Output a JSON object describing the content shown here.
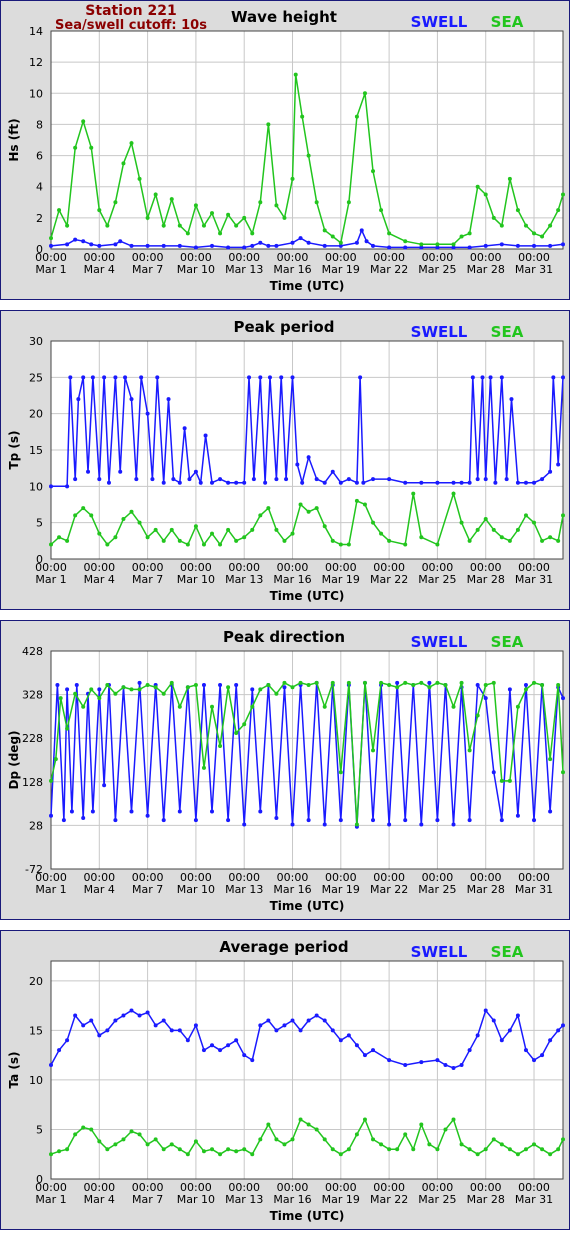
{
  "station": {
    "title": "Station 221",
    "subtitle": "Sea/swell cutoff: 10s"
  },
  "legend": {
    "swell_label": "SWELL",
    "sea_label": "SEA",
    "swell_color": "#1a1aff",
    "sea_color": "#22c51e"
  },
  "colors": {
    "panel_bg": "#dcdcdc",
    "plot_bg": "#ffffff",
    "grid": "#c8c8c8",
    "border": "#1a1a7a",
    "station_text": "#8b0000"
  },
  "shared_x": {
    "label": "Time (UTC)",
    "tick_days": [
      0,
      3,
      6,
      9,
      12,
      15,
      18,
      21,
      24,
      27,
      30
    ],
    "tick_time": "00:00",
    "tick_dates": [
      "Mar 1",
      "Mar 4",
      "Mar 7",
      "Mar 10",
      "Mar 13",
      "Mar 16",
      "Mar 19",
      "Mar 22",
      "Mar 25",
      "Mar 28",
      "Mar 31"
    ],
    "xlim": [
      0,
      31.8
    ]
  },
  "chart_data": [
    {
      "type": "line",
      "title": "Wave height",
      "xlabel": "Time (UTC)",
      "ylabel": "Hs (ft)",
      "ylim": [
        0,
        14
      ],
      "yticks": [
        0,
        2,
        4,
        6,
        8,
        10,
        12,
        14
      ],
      "grid": true,
      "series": [
        {
          "name": "SWELL",
          "x": [
            0,
            1,
            1.5,
            2,
            2.5,
            3,
            4,
            4.3,
            5,
            6,
            7,
            8,
            9,
            10,
            11,
            12,
            12.5,
            13,
            13.5,
            14,
            15,
            15.5,
            16,
            17,
            18,
            19,
            19.3,
            19.6,
            20,
            21,
            22,
            23,
            24,
            25,
            26,
            27,
            28,
            29,
            30,
            31,
            31.8
          ],
          "y": [
            0.2,
            0.3,
            0.6,
            0.5,
            0.3,
            0.2,
            0.3,
            0.5,
            0.2,
            0.2,
            0.2,
            0.2,
            0.1,
            0.2,
            0.1,
            0.1,
            0.2,
            0.4,
            0.2,
            0.2,
            0.4,
            0.7,
            0.4,
            0.2,
            0.2,
            0.4,
            1.2,
            0.5,
            0.2,
            0.1,
            0.1,
            0.1,
            0.1,
            0.1,
            0.1,
            0.2,
            0.3,
            0.2,
            0.2,
            0.2,
            0.3
          ]
        },
        {
          "name": "SEA",
          "x": [
            0,
            0.5,
            1,
            1.5,
            2,
            2.5,
            3,
            3.5,
            4,
            4.5,
            5,
            5.5,
            6,
            6.5,
            7,
            7.5,
            8,
            8.5,
            9,
            9.5,
            10,
            10.5,
            11,
            11.5,
            12,
            12.5,
            13,
            13.5,
            14,
            14.5,
            15,
            15.2,
            15.6,
            16,
            16.5,
            17,
            17.5,
            18,
            18.5,
            19,
            19.5,
            20,
            20.5,
            21,
            22,
            23,
            24,
            25,
            25.5,
            26,
            26.5,
            27,
            27.5,
            28,
            28.5,
            29,
            29.5,
            30,
            30.5,
            31,
            31.5,
            31.8
          ],
          "y": [
            0.7,
            2.5,
            1.5,
            6.5,
            8.2,
            6.5,
            2.5,
            1.5,
            3.0,
            5.5,
            6.8,
            4.5,
            2.0,
            3.5,
            1.5,
            3.2,
            1.5,
            1.0,
            2.8,
            1.5,
            2.3,
            1.0,
            2.2,
            1.5,
            2.0,
            1.0,
            3.0,
            8.0,
            2.8,
            2.0,
            4.5,
            11.2,
            8.5,
            6.0,
            3.0,
            1.2,
            0.8,
            0.4,
            3.0,
            8.5,
            10.0,
            5.0,
            2.5,
            1.0,
            0.5,
            0.3,
            0.3,
            0.3,
            0.8,
            1.0,
            4.0,
            3.5,
            2.0,
            1.5,
            4.5,
            2.5,
            1.5,
            1.0,
            0.8,
            1.5,
            2.5,
            3.5
          ]
        }
      ]
    },
    {
      "type": "line",
      "title": "Peak period",
      "xlabel": "Time (UTC)",
      "ylabel": "Tp (s)",
      "ylim": [
        0,
        30
      ],
      "yticks": [
        0,
        5,
        10,
        15,
        20,
        25,
        30
      ],
      "grid": true,
      "series": [
        {
          "name": "SWELL",
          "x": [
            0,
            1,
            1.2,
            1.5,
            1.7,
            2,
            2.3,
            2.6,
            3,
            3.3,
            3.6,
            4,
            4.3,
            4.6,
            5,
            5.3,
            5.6,
            6,
            6.3,
            6.6,
            7,
            7.3,
            7.6,
            8,
            8.3,
            8.6,
            9,
            9.3,
            9.6,
            10,
            10.5,
            11,
            11.5,
            12,
            12.3,
            12.6,
            13,
            13.3,
            13.6,
            14,
            14.3,
            14.6,
            15,
            15.3,
            15.6,
            16,
            16.5,
            17,
            17.5,
            18,
            18.5,
            19,
            19.2,
            19.4,
            20,
            21,
            22,
            23,
            24,
            25,
            25.5,
            26,
            26.2,
            26.5,
            26.8,
            27,
            27.3,
            27.6,
            28,
            28.3,
            28.6,
            29,
            29.5,
            30,
            30.5,
            31,
            31.2,
            31.5,
            31.8
          ],
          "y": [
            10,
            10,
            25,
            11,
            22,
            25,
            12,
            25,
            11,
            25,
            10.5,
            25,
            12,
            25,
            22,
            11,
            25,
            20,
            11,
            25,
            10.5,
            22,
            11,
            10.5,
            18,
            11,
            12,
            10.5,
            17,
            10.5,
            11,
            10.5,
            10.5,
            10.5,
            25,
            11,
            25,
            10.5,
            25,
            11,
            25,
            11,
            25,
            13,
            10.5,
            14,
            11,
            10.5,
            12,
            10.5,
            11,
            10.5,
            25,
            10.5,
            11,
            11,
            10.5,
            10.5,
            10.5,
            10.5,
            10.5,
            10.5,
            25,
            11,
            25,
            11,
            25,
            10.5,
            25,
            11,
            22,
            10.5,
            10.5,
            10.5,
            11,
            12,
            25,
            13,
            25
          ]
        },
        {
          "name": "SEA",
          "x": [
            0,
            0.5,
            1,
            1.5,
            2,
            2.5,
            3,
            3.5,
            4,
            4.5,
            5,
            5.5,
            6,
            6.5,
            7,
            7.5,
            8,
            8.5,
            9,
            9.5,
            10,
            10.5,
            11,
            11.5,
            12,
            12.5,
            13,
            13.5,
            14,
            14.5,
            15,
            15.5,
            16,
            16.5,
            17,
            17.5,
            18,
            18.5,
            19,
            19.5,
            20,
            20.5,
            21,
            22,
            22.5,
            23,
            24,
            25,
            25.5,
            26,
            26.5,
            27,
            27.5,
            28,
            28.5,
            29,
            29.5,
            30,
            30.5,
            31,
            31.5,
            31.8
          ],
          "y": [
            2,
            3,
            2.5,
            6,
            7,
            6,
            3.5,
            2,
            3,
            5.5,
            6.5,
            5,
            3,
            4,
            2.5,
            4,
            2.5,
            2,
            4.5,
            2,
            3.5,
            2,
            4,
            2.5,
            3,
            4,
            6,
            7,
            4,
            2.5,
            3.5,
            7.5,
            6.5,
            7,
            4.5,
            2.5,
            2,
            2,
            8,
            7.5,
            5,
            3.5,
            2.5,
            2,
            9,
            3,
            2,
            9,
            5,
            2.5,
            4,
            5.5,
            4,
            3,
            2.5,
            4,
            6,
            5,
            2.5,
            3,
            2.5,
            6
          ]
        }
      ]
    },
    {
      "type": "scatter",
      "title": "Peak direction",
      "xlabel": "Time (UTC)",
      "ylabel": "Dp (deg)",
      "ylim": [
        -72,
        428
      ],
      "yticks": [
        -72,
        28,
        128,
        228,
        328,
        428
      ],
      "grid": true,
      "series": [
        {
          "name": "SWELL",
          "x": [
            0,
            0.4,
            0.8,
            1,
            1.3,
            1.6,
            2,
            2.3,
            2.6,
            3,
            3.3,
            3.6,
            4,
            4.5,
            5,
            5.5,
            6,
            6.5,
            7,
            7.5,
            8,
            8.5,
            9,
            9.5,
            10,
            10.5,
            11,
            11.5,
            12,
            12.5,
            13,
            13.5,
            14,
            14.5,
            15,
            15.5,
            16,
            16.5,
            17,
            17.5,
            18,
            18.5,
            19,
            19.5,
            20,
            20.5,
            21,
            21.5,
            22,
            22.5,
            23,
            23.5,
            24,
            24.5,
            25,
            25.5,
            26,
            26.5,
            27,
            27.5,
            28,
            28.5,
            29,
            29.5,
            30,
            30.5,
            31,
            31.5,
            31.8
          ],
          "y": [
            50,
            350,
            40,
            340,
            60,
            350,
            45,
            330,
            60,
            340,
            120,
            350,
            40,
            345,
            60,
            355,
            50,
            350,
            40,
            350,
            60,
            345,
            40,
            350,
            60,
            350,
            40,
            350,
            30,
            340,
            60,
            350,
            45,
            345,
            30,
            350,
            40,
            355,
            30,
            350,
            40,
            350,
            25,
            355,
            40,
            350,
            30,
            355,
            40,
            350,
            30,
            355,
            40,
            350,
            30,
            345,
            40,
            350,
            320,
            150,
            40,
            340,
            50,
            350,
            40,
            350,
            60,
            345,
            320
          ]
        },
        {
          "name": "SEA",
          "x": [
            0,
            0.3,
            0.6,
            1,
            1.5,
            2,
            2.5,
            3,
            3.5,
            4,
            4.5,
            5,
            5.5,
            6,
            6.5,
            7,
            7.5,
            8,
            8.5,
            9,
            9.5,
            10,
            10.5,
            11,
            11.5,
            12,
            12.5,
            13,
            13.5,
            14,
            14.5,
            15,
            15.5,
            16,
            16.5,
            17,
            17.5,
            18,
            18.5,
            19,
            19.5,
            20,
            20.5,
            21,
            21.5,
            22,
            22.5,
            23,
            23.5,
            24,
            24.5,
            25,
            25.5,
            26,
            26.5,
            27,
            27.5,
            28,
            28.5,
            29,
            29.5,
            30,
            30.5,
            31,
            31.5,
            31.8
          ],
          "y": [
            130,
            180,
            320,
            250,
            330,
            300,
            340,
            320,
            350,
            330,
            345,
            340,
            340,
            350,
            345,
            330,
            355,
            300,
            345,
            350,
            160,
            300,
            210,
            345,
            240,
            260,
            300,
            340,
            350,
            330,
            355,
            345,
            355,
            350,
            355,
            300,
            355,
            150,
            355,
            30,
            355,
            200,
            355,
            350,
            345,
            355,
            350,
            355,
            345,
            355,
            350,
            300,
            355,
            200,
            280,
            350,
            355,
            130,
            130,
            300,
            340,
            355,
            350,
            180,
            350,
            150
          ]
        }
      ]
    },
    {
      "type": "line",
      "title": "Average period",
      "xlabel": "Time (UTC)",
      "ylabel": "Ta (s)",
      "ylim": [
        0,
        22
      ],
      "yticks": [
        0,
        5,
        10,
        15,
        20
      ],
      "grid": true,
      "series": [
        {
          "name": "SWELL",
          "x": [
            0,
            0.5,
            1,
            1.5,
            2,
            2.5,
            3,
            3.5,
            4,
            4.5,
            5,
            5.5,
            6,
            6.5,
            7,
            7.5,
            8,
            8.5,
            9,
            9.5,
            10,
            10.5,
            11,
            11.5,
            12,
            12.5,
            13,
            13.5,
            14,
            14.5,
            15,
            15.5,
            16,
            16.5,
            17,
            17.5,
            18,
            18.5,
            19,
            19.5,
            20,
            21,
            22,
            23,
            24,
            24.5,
            25,
            25.5,
            26,
            26.5,
            27,
            27.5,
            28,
            28.5,
            29,
            29.5,
            30,
            30.5,
            31,
            31.5,
            31.8
          ],
          "y": [
            11.5,
            13,
            14,
            16.5,
            15.5,
            16,
            14.5,
            15,
            16,
            16.5,
            17,
            16.5,
            16.8,
            15.5,
            16,
            15,
            15,
            14,
            15.5,
            13,
            13.5,
            13,
            13.5,
            14,
            12.5,
            12,
            15.5,
            16,
            15,
            15.5,
            16,
            15,
            16,
            16.5,
            16,
            15,
            14,
            14.5,
            13.5,
            12.5,
            13,
            12,
            11.5,
            11.8,
            12,
            11.5,
            11.2,
            11.5,
            13,
            14.5,
            17,
            16,
            14,
            15,
            16.5,
            13,
            12,
            12.5,
            14,
            15,
            15.5
          ]
        },
        {
          "name": "SEA",
          "x": [
            0,
            0.5,
            1,
            1.5,
            2,
            2.5,
            3,
            3.5,
            4,
            4.5,
            5,
            5.5,
            6,
            6.5,
            7,
            7.5,
            8,
            8.5,
            9,
            9.5,
            10,
            10.5,
            11,
            11.5,
            12,
            12.5,
            13,
            13.5,
            14,
            14.5,
            15,
            15.5,
            16,
            16.5,
            17,
            17.5,
            18,
            18.5,
            19,
            19.5,
            20,
            20.5,
            21,
            21.5,
            22,
            22.5,
            23,
            23.5,
            24,
            24.5,
            25,
            25.5,
            26,
            26.5,
            27,
            27.5,
            28,
            28.5,
            29,
            29.5,
            30,
            30.5,
            31,
            31.5,
            31.8
          ],
          "y": [
            2.5,
            2.8,
            3,
            4.5,
            5.2,
            5,
            3.8,
            3,
            3.5,
            4,
            4.8,
            4.5,
            3.5,
            4,
            3,
            3.5,
            3,
            2.5,
            3.8,
            2.8,
            3,
            2.5,
            3,
            2.8,
            3,
            2.5,
            4,
            5.5,
            4,
            3.5,
            4,
            6,
            5.5,
            5,
            4,
            3,
            2.5,
            3,
            4.5,
            6,
            4,
            3.5,
            3,
            3,
            4.5,
            3,
            5.5,
            3.5,
            3,
            5,
            6,
            3.5,
            3,
            2.5,
            3,
            4,
            3.5,
            3,
            2.5,
            3,
            3.5,
            3,
            2.5,
            3,
            4
          ]
        }
      ]
    }
  ]
}
